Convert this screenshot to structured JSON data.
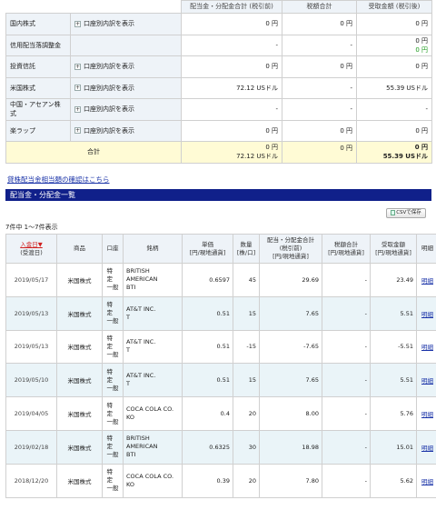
{
  "summary": {
    "headers": {
      "dividend": "配当金・分配金合計 (税引前)",
      "tax": "税額合計",
      "received": "受取金額 (税引後)"
    },
    "rows": [
      {
        "label": "国内株式",
        "has_acct": true,
        "dividend": "0 円",
        "dividend2": "",
        "tax": "0 円",
        "received": "0 円",
        "received2": ""
      },
      {
        "label": "信用配当落調整金",
        "has_acct": false,
        "dividend": "-",
        "dividend2": "",
        "tax": "-",
        "received": "0 円",
        "received2": "0 円"
      },
      {
        "label": "投資信託",
        "has_acct": true,
        "dividend": "0 円",
        "dividend2": "",
        "tax": "0 円",
        "received": "0 円",
        "received2": ""
      },
      {
        "label": "米国株式",
        "has_acct": true,
        "dividend": "72.12 USドル",
        "dividend2": "",
        "tax": "-",
        "received": "55.39 USドル",
        "received2": ""
      },
      {
        "label": "中国・アセアン株式",
        "has_acct": true,
        "dividend": "-",
        "dividend2": "",
        "tax": "-",
        "received": "-",
        "received2": ""
      },
      {
        "label": "楽ラップ",
        "has_acct": true,
        "dividend": "0 円",
        "dividend2": "",
        "tax": "0 円",
        "received": "0 円",
        "received2": ""
      }
    ],
    "acct_label": "口座別内訳を表示",
    "total": {
      "label": "合計",
      "dividend": "0 円",
      "dividend2": "72.12 USドル",
      "tax": "0 円",
      "received": "0 円",
      "received2": "55.39 USドル"
    }
  },
  "link_stock_lending": "貸株配当金相当額の確認はこちら",
  "section_title": "配当金・分配金一覧",
  "csv_button": "CSVで保存",
  "count_text": "7件中 1～7件表示",
  "detail": {
    "headers": {
      "date": "入金日▼",
      "date_sub": "(受渡日)",
      "product": "商品",
      "account": "口座",
      "name": "銘柄",
      "unit": "単価",
      "unit_sub": "[円/現地通貨]",
      "qty": "数量",
      "qty_sub": "[株/口]",
      "dividend": "配当・分配金合計",
      "dividend_sub1": "(税引前)",
      "dividend_sub2": "[円/現地通貨]",
      "tax": "税額合計",
      "tax_sub": "[円/現地通貨]",
      "received": "受取金額",
      "received_sub": "[円/現地通貨]",
      "detail": "明細"
    },
    "account_type": [
      "特",
      "定",
      "一般"
    ],
    "rows": [
      {
        "date": "2019/05/17",
        "product": "米国株式",
        "name": [
          "BRITISH",
          "AMERICAN",
          "BTI"
        ],
        "unit": "0.6597",
        "qty": "45",
        "dividend": "29.69",
        "tax": "-",
        "received": "23.49",
        "detail": "明細"
      },
      {
        "date": "2019/05/13",
        "product": "米国株式",
        "name": [
          "AT&T INC.",
          "T"
        ],
        "unit": "0.51",
        "qty": "15",
        "dividend": "7.65",
        "tax": "-",
        "received": "5.51",
        "detail": "明細"
      },
      {
        "date": "2019/05/13",
        "product": "米国株式",
        "name": [
          "AT&T INC.",
          "T"
        ],
        "unit": "0.51",
        "qty": "-15",
        "dividend": "-7.65",
        "tax": "-",
        "received": "-5.51",
        "detail": "明細"
      },
      {
        "date": "2019/05/10",
        "product": "米国株式",
        "name": [
          "AT&T INC.",
          "T"
        ],
        "unit": "0.51",
        "qty": "15",
        "dividend": "7.65",
        "tax": "-",
        "received": "5.51",
        "detail": "明細"
      },
      {
        "date": "2019/04/05",
        "product": "米国株式",
        "name": [
          "COCA COLA CO.",
          "KO"
        ],
        "unit": "0.4",
        "qty": "20",
        "dividend": "8.00",
        "tax": "-",
        "received": "5.76",
        "detail": "明細"
      },
      {
        "date": "2019/02/18",
        "product": "米国株式",
        "name": [
          "BRITISH",
          "AMERICAN",
          "BTI"
        ],
        "unit": "0.6325",
        "qty": "30",
        "dividend": "18.98",
        "tax": "-",
        "received": "15.01",
        "detail": "明細"
      },
      {
        "date": "2018/12/20",
        "product": "米国株式",
        "name": [
          "COCA COLA CO.",
          "KO"
        ],
        "unit": "0.39",
        "qty": "20",
        "dividend": "7.80",
        "tax": "-",
        "received": "5.62",
        "detail": "明細"
      }
    ]
  }
}
